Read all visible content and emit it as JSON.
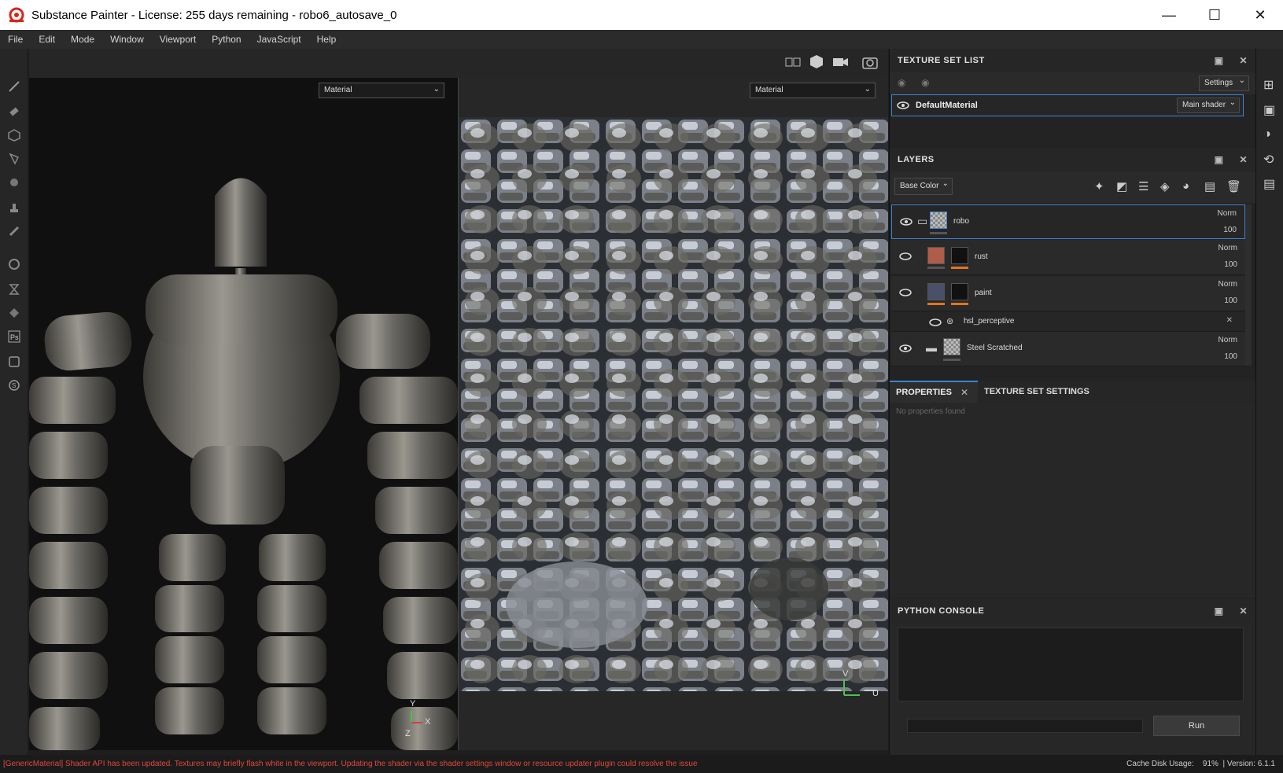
{
  "window": {
    "title": "Substance Painter - License: 255 days remaining - robo6_autosave_0",
    "minimize": "—",
    "maximize": "☐",
    "close": "✕"
  },
  "menu": [
    "File",
    "Edit",
    "Mode",
    "Window",
    "Viewport",
    "Python",
    "JavaScript",
    "Help"
  ],
  "viewport": {
    "left_dropdown": "Material",
    "right_dropdown": "Material",
    "axis_3d": {
      "y": "Y",
      "x": "X",
      "z": "Z"
    },
    "axis_uv": {
      "v": "V",
      "u": "U"
    }
  },
  "texture_set_list": {
    "title": "TEXTURE SET LIST",
    "settings_label": "Settings",
    "material_name": "DefaultMaterial",
    "shader": "Main shader"
  },
  "layers": {
    "title": "LAYERS",
    "channel": "Base Color",
    "items": [
      {
        "name": "robo",
        "blend": "Norm",
        "opacity": "100"
      },
      {
        "name": "rust",
        "blend": "Norm",
        "opacity": "100"
      },
      {
        "name": "paint",
        "blend": "Norm",
        "opacity": "100"
      },
      {
        "name": "hsl_perceptive"
      },
      {
        "name": "Steel Scratched",
        "blend": "Norm",
        "opacity": "100"
      }
    ]
  },
  "properties": {
    "tab1": "PROPERTIES",
    "tab2": "TEXTURE SET SETTINGS",
    "empty_text": "No properties found"
  },
  "python_console": {
    "title": "PYTHON CONSOLE",
    "run_label": "Run"
  },
  "status": {
    "message": "[GenericMaterial] Shader API has been updated. Textures may briefly flash white in the viewport. Updating the shader via the shader settings window or resource updater plugin could resolve the issue",
    "cache_label": "Cache Disk Usage:",
    "cache_value": "91%",
    "version": "Version: 6.1.1"
  },
  "colors": {
    "accent_blue": "#3c82d6",
    "status_red": "#e0483c",
    "orange_mask": "#e0761f"
  }
}
